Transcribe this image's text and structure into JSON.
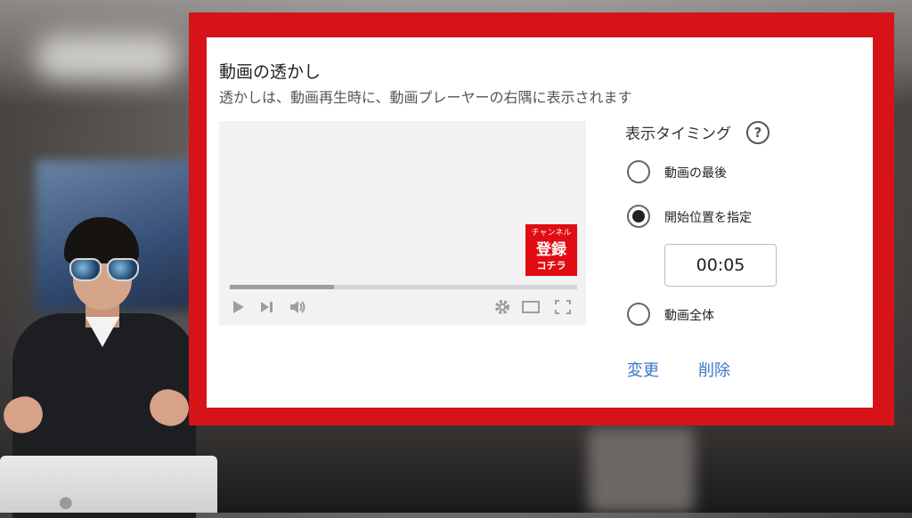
{
  "dialog": {
    "title": "動画の透かし",
    "subtitle": "透かしは、動画再生時に、動画プレーヤーの右隅に表示されます"
  },
  "preview": {
    "badge": {
      "line1": "チャンネル",
      "line2": "登録",
      "line3": "コチラ"
    },
    "progress_fraction": 0.3,
    "controls": [
      "play-icon",
      "next-icon",
      "volume-icon",
      "gear-icon",
      "theater-icon",
      "fullscreen-icon"
    ]
  },
  "timing": {
    "label": "表示タイミング",
    "help_glyph": "?",
    "options": [
      {
        "label": "動画の最後",
        "selected": false
      },
      {
        "label": "開始位置を指定",
        "selected": true
      },
      {
        "label": "動画全体",
        "selected": false
      }
    ],
    "start_time": "00:05"
  },
  "actions": {
    "change": "変更",
    "delete": "削除"
  },
  "colors": {
    "frame": "#d7131a",
    "badge": "#e10b14",
    "link": "#3a77c8"
  }
}
